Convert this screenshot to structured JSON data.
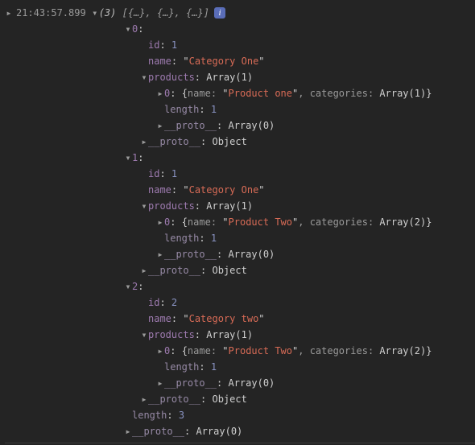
{
  "header": {
    "timestamp": "21:43:57.899",
    "count_prefix": "(3)",
    "preview": "[{…}, {…}, {…}]",
    "info": "i"
  },
  "array": {
    "length_label": "length",
    "length_value": "3",
    "proto_label": "__proto__",
    "proto_value": "Array(0)"
  },
  "common": {
    "id_label": "id",
    "name_label": "name",
    "products_label": "products",
    "products_value": "Array(1)",
    "item_index": "0",
    "inner_name_key": "name",
    "inner_cat_key": "categories",
    "length_label": "length",
    "length_value": "1",
    "proto_label": "__proto__",
    "proto_arr_value": "Array(0)",
    "proto_obj_value": "Object"
  },
  "items": {
    "i0": {
      "index": "0",
      "id": "1",
      "name": "Category One",
      "product_name": "Product one",
      "product_cats": "Array(1)"
    },
    "i1": {
      "index": "1",
      "id": "1",
      "name": "Category One",
      "product_name": "Product Two",
      "product_cats": "Array(2)"
    },
    "i2": {
      "index": "2",
      "id": "2",
      "name": "Category two",
      "product_name": "Product Two",
      "product_cats": "Array(2)"
    }
  }
}
